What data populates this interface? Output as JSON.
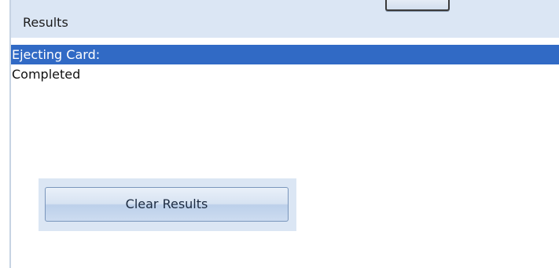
{
  "header": {
    "title": "Results"
  },
  "results": {
    "items": [
      {
        "text": "Ejecting Card:",
        "selected": true
      },
      {
        "text": "Completed",
        "selected": false
      }
    ]
  },
  "actions": {
    "clear_label": "Clear Results"
  },
  "colors": {
    "header_background": "#dbe6f4",
    "selection": "#316ac5"
  }
}
